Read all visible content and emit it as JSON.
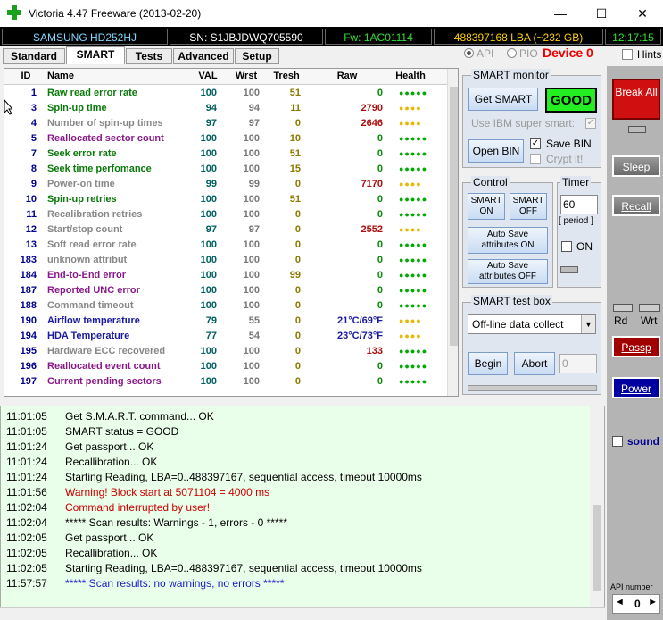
{
  "window": {
    "title": "Victoria 4.47  Freeware (2013-02-20)",
    "minimize": "—",
    "maximize": "☐",
    "close": "✕"
  },
  "info": {
    "model": "SAMSUNG HD252HJ",
    "serial": "SN: S1JBJDWQ705590",
    "firmware": "Fw: 1AC01114",
    "lba": "488397168 LBA (~232 GB)",
    "time": "12:17:15"
  },
  "tabs": [
    "Standard",
    "SMART",
    "Tests",
    "Advanced",
    "Setup"
  ],
  "mode": {
    "api": "API",
    "pio": "PIO",
    "device": "Device 0",
    "hints": "Hints"
  },
  "table": {
    "headers": [
      "ID",
      "Name",
      "VAL",
      "Wrst",
      "Tresh",
      "Raw",
      "Health"
    ],
    "rows": [
      {
        "id": "1",
        "name": "Raw read error rate",
        "val": "100",
        "wrst": "100",
        "tresh": "51",
        "raw": "0",
        "health": "●●●●●",
        "color": "#0a7a0a",
        "hcolor": "#00aa00"
      },
      {
        "id": "3",
        "name": "Spin-up time",
        "val": "94",
        "wrst": "94",
        "tresh": "11",
        "raw": "2790",
        "health": "●●●●",
        "color": "#0a7a0a",
        "hcolor": "#e8b800"
      },
      {
        "id": "4",
        "name": "Number of spin-up times",
        "val": "97",
        "wrst": "97",
        "tresh": "0",
        "raw": "2646",
        "health": "●●●●",
        "color": "#888888",
        "hcolor": "#e8b800"
      },
      {
        "id": "5",
        "name": "Reallocated sector count",
        "val": "100",
        "wrst": "100",
        "tresh": "10",
        "raw": "0",
        "health": "●●●●●",
        "color": "#8a1a8a",
        "hcolor": "#00aa00"
      },
      {
        "id": "7",
        "name": "Seek error rate",
        "val": "100",
        "wrst": "100",
        "tresh": "51",
        "raw": "0",
        "health": "●●●●●",
        "color": "#0a7a0a",
        "hcolor": "#00aa00"
      },
      {
        "id": "8",
        "name": "Seek time perfomance",
        "val": "100",
        "wrst": "100",
        "tresh": "15",
        "raw": "0",
        "health": "●●●●●",
        "color": "#0a7a0a",
        "hcolor": "#00aa00"
      },
      {
        "id": "9",
        "name": "Power-on time",
        "val": "99",
        "wrst": "99",
        "tresh": "0",
        "raw": "7170",
        "health": "●●●●",
        "color": "#888888",
        "hcolor": "#e8b800"
      },
      {
        "id": "10",
        "name": "Spin-up retries",
        "val": "100",
        "wrst": "100",
        "tresh": "51",
        "raw": "0",
        "health": "●●●●●",
        "color": "#0a7a0a",
        "hcolor": "#00aa00"
      },
      {
        "id": "11",
        "name": "Recalibration retries",
        "val": "100",
        "wrst": "100",
        "tresh": "0",
        "raw": "0",
        "health": "●●●●●",
        "color": "#888888",
        "hcolor": "#00aa00"
      },
      {
        "id": "12",
        "name": "Start/stop count",
        "val": "97",
        "wrst": "97",
        "tresh": "0",
        "raw": "2552",
        "health": "●●●●",
        "color": "#888888",
        "hcolor": "#e8b800"
      },
      {
        "id": "13",
        "name": "Soft read error rate",
        "val": "100",
        "wrst": "100",
        "tresh": "0",
        "raw": "0",
        "health": "●●●●●",
        "color": "#888888",
        "hcolor": "#00aa00"
      },
      {
        "id": "183",
        "name": "unknown attribut",
        "val": "100",
        "wrst": "100",
        "tresh": "0",
        "raw": "0",
        "health": "●●●●●",
        "color": "#888888",
        "hcolor": "#00aa00"
      },
      {
        "id": "184",
        "name": "End-to-End error",
        "val": "100",
        "wrst": "100",
        "tresh": "99",
        "raw": "0",
        "health": "●●●●●",
        "color": "#8a1a8a",
        "hcolor": "#00aa00"
      },
      {
        "id": "187",
        "name": "Reported UNC error",
        "val": "100",
        "wrst": "100",
        "tresh": "0",
        "raw": "0",
        "health": "●●●●●",
        "color": "#8a1a8a",
        "hcolor": "#00aa00"
      },
      {
        "id": "188",
        "name": "Command timeout",
        "val": "100",
        "wrst": "100",
        "tresh": "0",
        "raw": "0",
        "health": "●●●●●",
        "color": "#888888",
        "hcolor": "#00aa00"
      },
      {
        "id": "190",
        "name": "Airflow temperature",
        "val": "79",
        "wrst": "55",
        "tresh": "0",
        "raw": "21°C/69°F",
        "health": "●●●●",
        "color": "#1a1aa0",
        "hcolor": "#e8b800"
      },
      {
        "id": "194",
        "name": "HDA Temperature",
        "val": "77",
        "wrst": "54",
        "tresh": "0",
        "raw": "23°C/73°F",
        "health": "●●●●",
        "color": "#1a1aa0",
        "hcolor": "#e8b800"
      },
      {
        "id": "195",
        "name": "Hardware ECC recovered",
        "val": "100",
        "wrst": "100",
        "tresh": "0",
        "raw": "133",
        "health": "●●●●●",
        "color": "#888888",
        "hcolor": "#00aa00"
      },
      {
        "id": "196",
        "name": "Reallocated event count",
        "val": "100",
        "wrst": "100",
        "tresh": "0",
        "raw": "0",
        "health": "●●●●●",
        "color": "#8a1a8a",
        "hcolor": "#00aa00"
      },
      {
        "id": "197",
        "name": "Current pending sectors",
        "val": "100",
        "wrst": "100",
        "tresh": "0",
        "raw": "0",
        "health": "●●●●●",
        "color": "#8a1a8a",
        "hcolor": "#00aa00"
      }
    ]
  },
  "smart_monitor": {
    "label": "SMART monitor",
    "get_smart": "Get SMART",
    "status": "GOOD",
    "ibm": "Use IBM super smart:",
    "open_bin": "Open BIN",
    "save_bin": "Save BIN",
    "crypt": "Crypt it!"
  },
  "control": {
    "label": "Control",
    "smart_on": "SMART ON",
    "smart_off": "SMART OFF",
    "autosave_on": "Auto Save attributes ON",
    "autosave_off": "Auto Save attributes OFF"
  },
  "timer": {
    "label": "Timer",
    "value": "60",
    "period": "[ period ]",
    "on": "ON"
  },
  "test_box": {
    "label": "SMART test box",
    "selected": "Off-line data collect",
    "begin": "Begin",
    "abort": "Abort",
    "value": "0"
  },
  "right": {
    "break": "Break All",
    "sleep": "Sleep",
    "recall": "Recall",
    "rd": "Rd",
    "wrt": "Wrt",
    "passp": "Passp",
    "power": "Power",
    "sound": "sound",
    "api_number": "API number",
    "api_value": "0"
  },
  "log": [
    {
      "time": "11:01:05",
      "msg": "Get S.M.A.R.T. command... OK",
      "color": "#000000"
    },
    {
      "time": "11:01:05",
      "msg": "SMART status = GOOD",
      "color": "#000000"
    },
    {
      "time": "11:01:24",
      "msg": "Get passport... OK",
      "color": "#000000"
    },
    {
      "time": "11:01:24",
      "msg": "Recallibration... OK",
      "color": "#000000"
    },
    {
      "time": "11:01:24",
      "msg": "Starting Reading, LBA=0..488397167, sequential access, timeout 10000ms",
      "color": "#000000"
    },
    {
      "time": "11:01:56",
      "msg": "Warning! Block start at 5071104 = 4000 ms",
      "color": "#cc0000"
    },
    {
      "time": "11:02:04",
      "msg": "Command interrupted by user!",
      "color": "#cc0000"
    },
    {
      "time": "11:02:04",
      "msg": "***** Scan results: Warnings - 1, errors - 0 *****",
      "color": "#000000"
    },
    {
      "time": "11:02:05",
      "msg": "Get passport... OK",
      "color": "#000000"
    },
    {
      "time": "11:02:05",
      "msg": "Recallibration... OK",
      "color": "#000000"
    },
    {
      "time": "11:02:05",
      "msg": "Starting Reading, LBA=0..488397167, sequential access, timeout 10000ms",
      "color": "#000000"
    },
    {
      "time": "11:57:57",
      "msg": "***** Scan results: no warnings, no errors *****",
      "color": "#1a1acc"
    }
  ]
}
